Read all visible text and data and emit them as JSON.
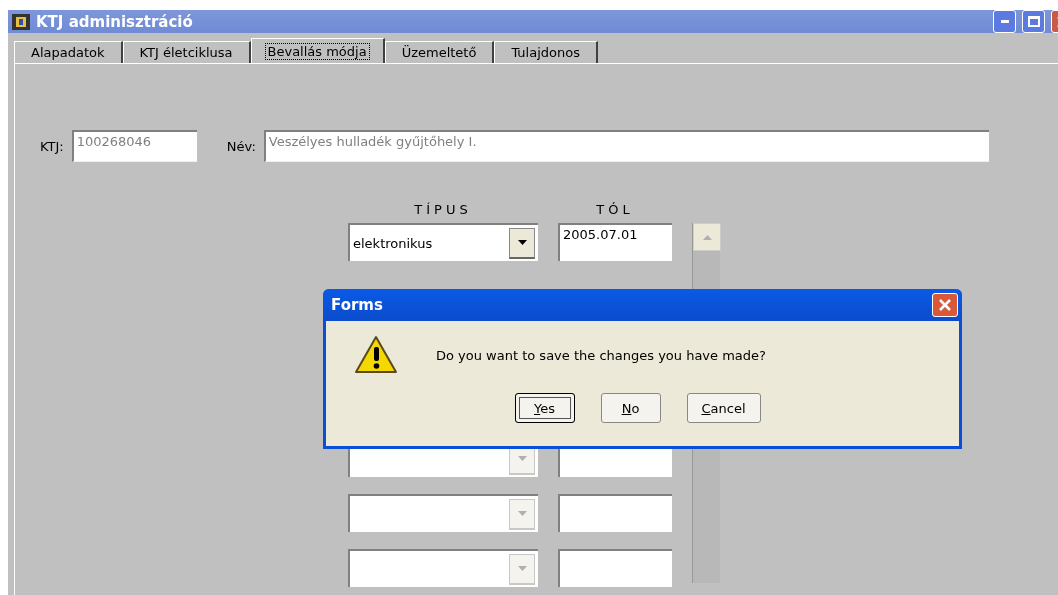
{
  "window": {
    "title": "KTJ adminisztráció"
  },
  "tabs": [
    {
      "label": "Alapadatok",
      "selected": false
    },
    {
      "label": "KTJ életciklusa",
      "selected": false
    },
    {
      "label": "Bevallás módja",
      "selected": true
    },
    {
      "label": "Üzemeltető",
      "selected": false
    },
    {
      "label": "Tulajdonos",
      "selected": false
    }
  ],
  "header": {
    "ktj_label": "KTJ:",
    "ktj_value": "100268046",
    "name_label": "Név:",
    "name_value": "Veszélyes hulladék gyűjtőhely I."
  },
  "columns": [
    "TÍPUS",
    "TÓL"
  ],
  "rows": [
    {
      "type": "elektronikus",
      "from": "2005.07.01",
      "disabled": false
    },
    {
      "disabled": true
    },
    {
      "disabled": true
    },
    {
      "disabled": true
    }
  ],
  "dialog": {
    "title": "Forms",
    "message": "Do you want to save the changes you have made?",
    "buttons": [
      {
        "label": "Yes",
        "selected": true
      },
      {
        "label": "No",
        "selected": false
      },
      {
        "label": "Cancel",
        "selected": false
      }
    ]
  }
}
